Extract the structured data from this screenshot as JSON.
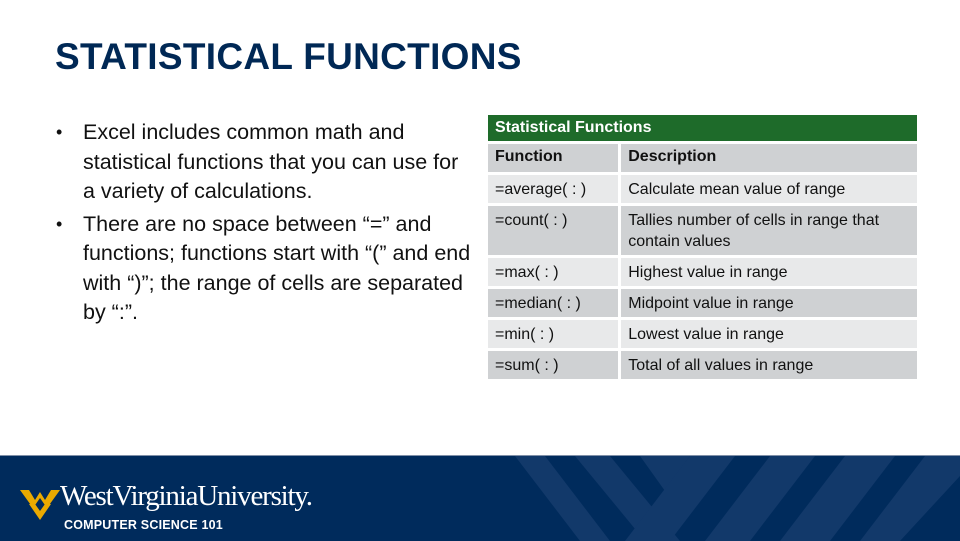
{
  "slide": {
    "title": "STATISTICAL FUNCTIONS",
    "bullets": [
      "Excel includes common math and statistical functions that you can use for a variety of calculations.",
      "There are no space between “=” and functions; functions start with “(” and end with “)”; the range of cells are separated by “:”."
    ],
    "bullet_glyph": "•"
  },
  "table": {
    "caption": "Statistical Functions",
    "headers": [
      "Function",
      "Description"
    ],
    "rows": [
      {
        "function": "=average( : )",
        "description": "Calculate mean value of range"
      },
      {
        "function": "=count( : )",
        "description": "Tallies number of cells in range that contain values"
      },
      {
        "function": "=max( : )",
        "description": "Highest value in range"
      },
      {
        "function": "=median( : )",
        "description": "Midpoint value in range"
      },
      {
        "function": "=min( : )",
        "description": "Lowest value in range"
      },
      {
        "function": "=sum( : )",
        "description": "Total of all values in range"
      }
    ]
  },
  "footer": {
    "university": "WestVirginiaUniversity.",
    "course": "COMPUTER SCIENCE 101",
    "logo_icon": "flying-wv-logo-icon"
  },
  "colors": {
    "title": "#002855",
    "table_caption_bg": "#1e6b2a",
    "row_dark": "#cfd1d3",
    "row_light": "#e8e9ea",
    "footer_bg": "#002b5c",
    "logo_gold": "#eaaa00"
  }
}
